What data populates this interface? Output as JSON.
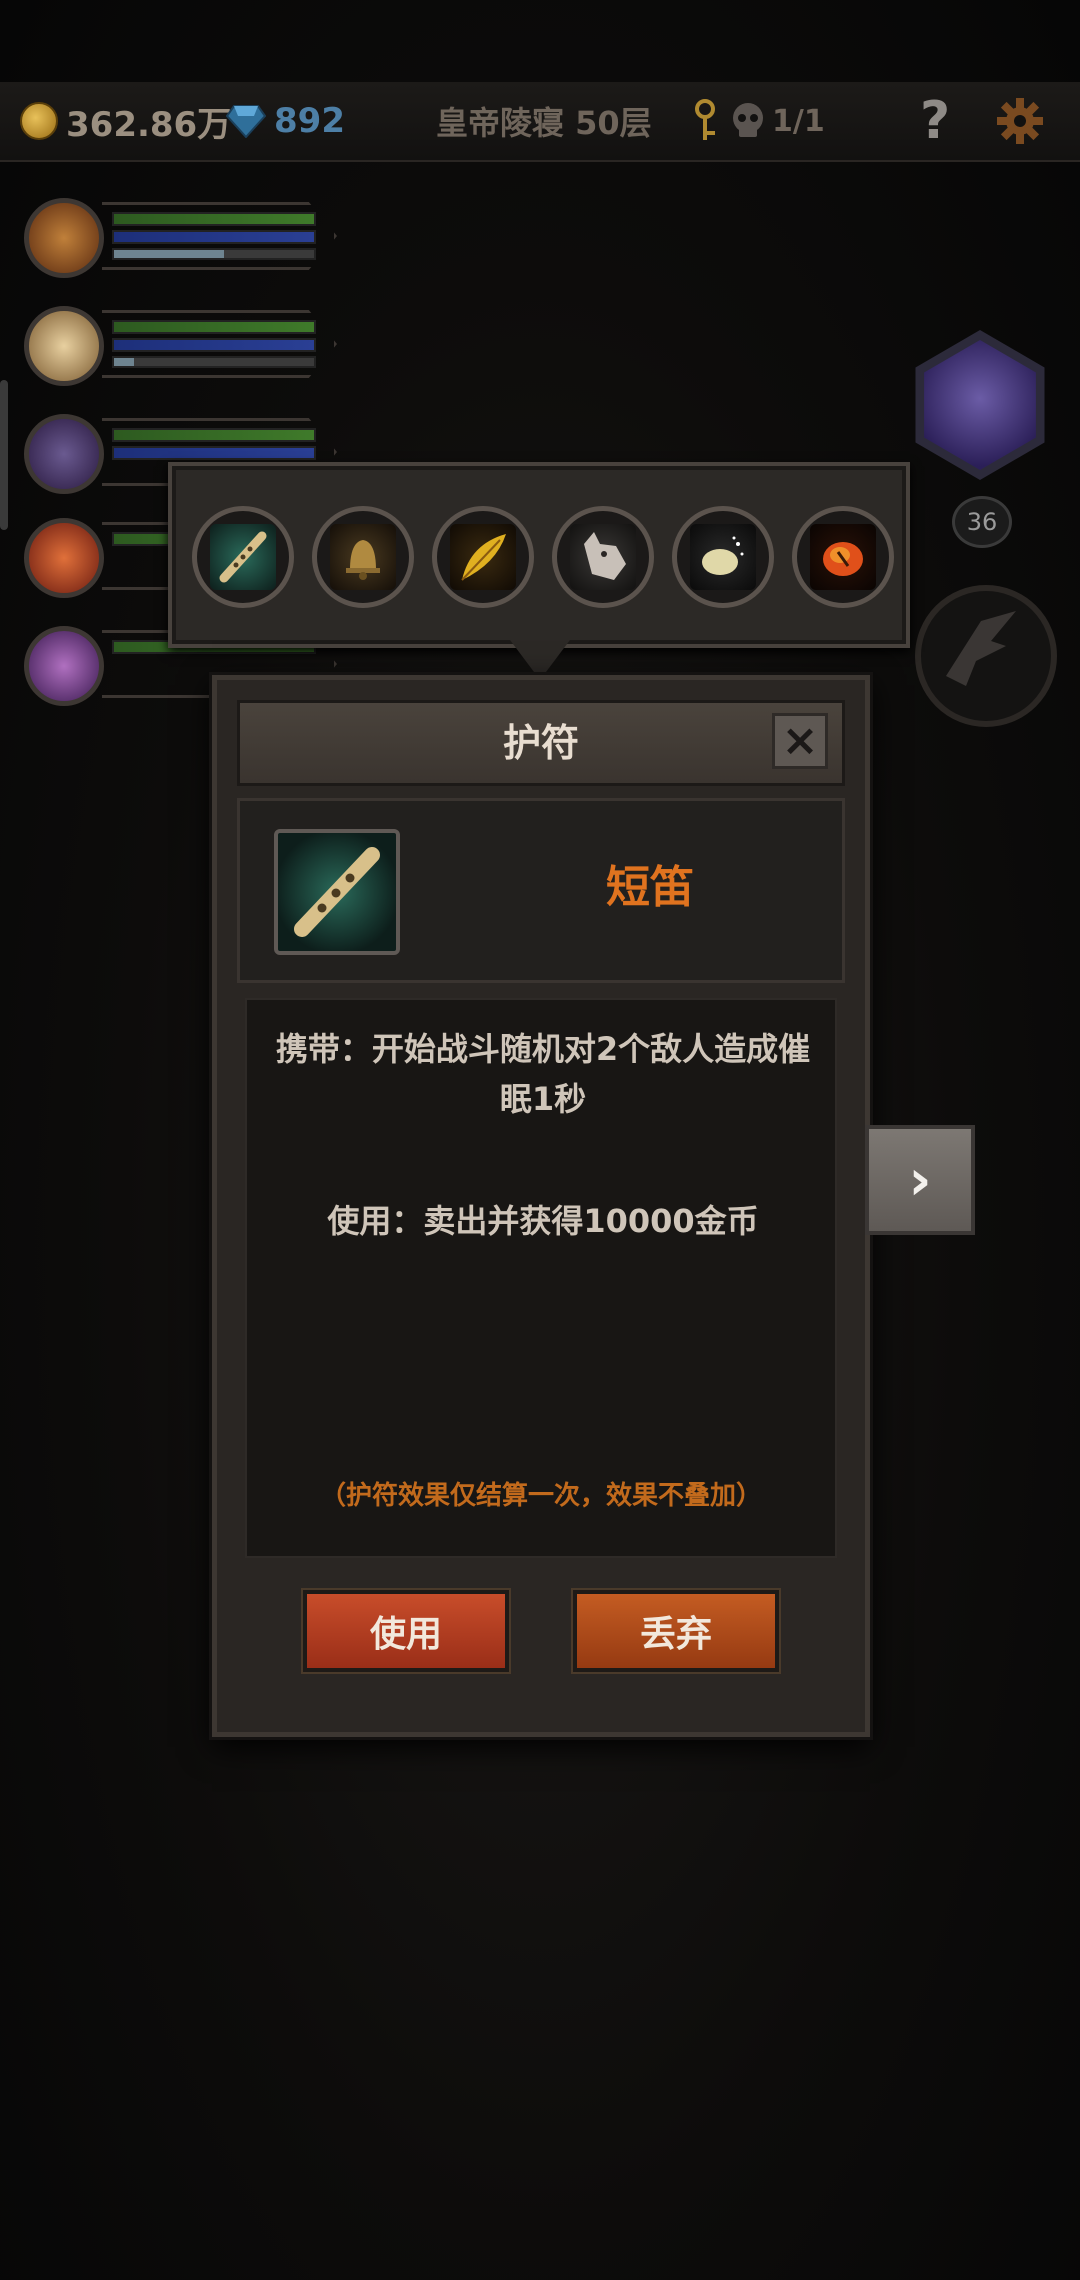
{
  "topbar": {
    "coins": "362.86万",
    "gems": "892",
    "floor": "皇帝陵寝 50层",
    "keys": "1/1",
    "help": "?",
    "colors": {
      "gold": "#e8c15a",
      "gem": "#4d7fa6"
    }
  },
  "heroes": [
    {
      "name": "hero-1",
      "xp": 0.55
    },
    {
      "name": "hero-2",
      "xp": 0.1
    },
    {
      "name": "hero-3",
      "xp": 0.0
    },
    {
      "name": "hero-4",
      "xp": 0.0
    },
    {
      "name": "hero-5",
      "xp": 0.0
    }
  ],
  "boss": {
    "level": "36"
  },
  "amulets": [
    {
      "icon": "flute-icon",
      "color": "#2a6a5a"
    },
    {
      "icon": "bell-icon",
      "color": "#8a6a30"
    },
    {
      "icon": "feather-icon",
      "color": "#d4a020"
    },
    {
      "icon": "wolf-head-icon",
      "color": "#9a9088"
    },
    {
      "icon": "stone-icon",
      "color": "#d8d0a0"
    },
    {
      "icon": "amber-icon",
      "color": "#e0501a"
    }
  ],
  "dialog": {
    "title": "护符",
    "close_label": "×",
    "item_name": "短笛",
    "desc_carry": "携带：开始战斗随机对2个敌人造成催眠1秒",
    "desc_use": "使用：卖出并获得10000金币",
    "note": "（护符效果仅结算一次，效果不叠加）",
    "use_label": "使用",
    "drop_label": "丢弃",
    "accent": "#e0731f"
  },
  "next_label": "›"
}
